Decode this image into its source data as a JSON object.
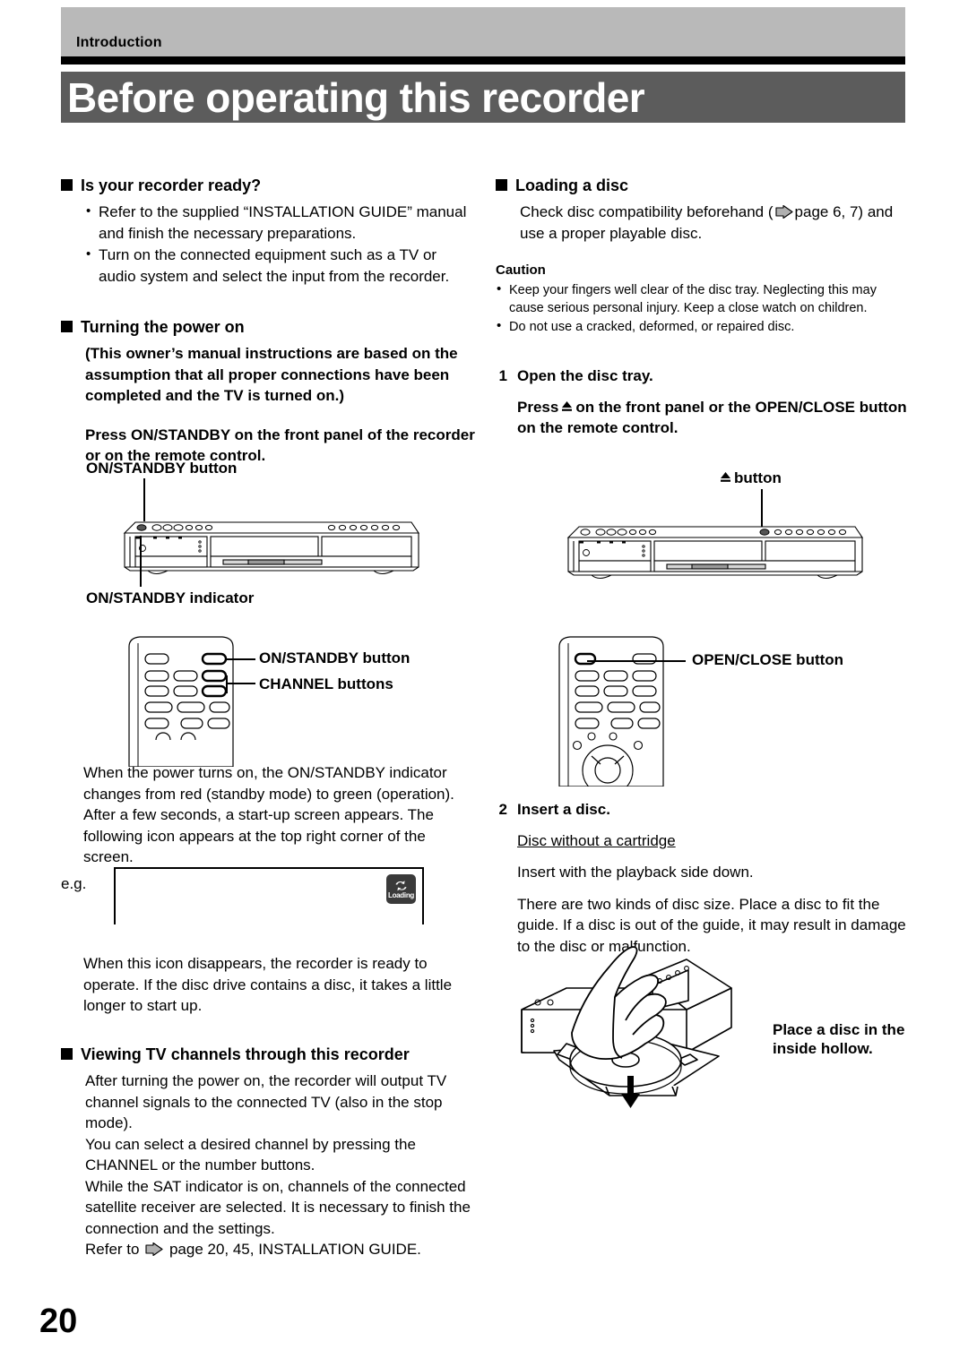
{
  "header": {
    "section_label": "Introduction",
    "title": "Before operating this recorder",
    "band_color": "#b9b9b9",
    "title_band_color": "#5c5c5c"
  },
  "page_number": "20",
  "left_column": {
    "section1": {
      "heading": "Is your recorder ready?",
      "bullets": [
        "Refer to the supplied “INSTALLATION GUIDE” manual and finish the necessary preparations.",
        "Turn on the connected equipment such as a TV or audio system and select the input from the recorder."
      ]
    },
    "section2": {
      "heading": "Turning the power on",
      "note": "(This owner’s manual instructions are based on the assumption that all proper connections have been completed and the TV is turned on.)",
      "instruction": "Press ON/STANDBY on the front panel of the recorder or on the remote control.",
      "front_panel_label": "ON/STANDBY button",
      "indicator_label": "ON/STANDBY indicator",
      "remote_label_1": "ON/STANDBY button",
      "remote_label_2": "CHANNEL buttons",
      "paragraph": "When the power turns on, the ON/STANDBY indicator changes from red (standby mode) to green (operation). After a few seconds, a start-up screen appears. The following icon appears at the top right corner of the screen.",
      "eg_label": "e.g.",
      "loading_icon_text": "Loading",
      "paragraph2": "When this icon disappears, the recorder is ready to operate.  If the disc drive contains a disc, it takes a little longer to start up."
    },
    "section3": {
      "heading": "Viewing TV channels through this recorder",
      "paragraphs": [
        "After turning the power on, the recorder will output TV channel signals to the connected TV (also in the stop mode).",
        "You can select a desired channel by pressing the CHANNEL or the number buttons.",
        "While the SAT indicator is on, channels of the connected satellite receiver are selected. It is necessary to finish the connection and the settings."
      ],
      "refer_prefix": "Refer to",
      "refer_suffix": "page 20, 45, INSTALLATION GUIDE."
    }
  },
  "right_column": {
    "section1": {
      "heading": "Loading a disc",
      "intro_before": "Check disc compatibility beforehand (",
      "intro_after": "page 6, 7) and use a proper playable disc.",
      "caution_heading": "Caution",
      "caution_bullets": [
        "Keep your fingers well clear of the disc tray. Neglecting this may cause serious personal injury.  Keep a close watch on children.",
        "Do not use a cracked, deformed, or repaired disc."
      ]
    },
    "step1": {
      "number": "1",
      "title": "Open the disc tray.",
      "text_before": "Press",
      "text_after": "on the front panel or the OPEN/CLOSE button on the remote control.",
      "front_panel_label": "button",
      "remote_label": "OPEN/CLOSE button"
    },
    "step2": {
      "number": "2",
      "title": "Insert a disc.",
      "subheading": "Disc without a cartridge",
      "line1": "Insert with the playback side down.",
      "line2": "There are two kinds of disc size. Place a disc to fit the guide. If a disc is out of the guide, it may result in damage to the disc or malfunction.",
      "figure_caption": "Place a disc in the inside hollow."
    }
  }
}
